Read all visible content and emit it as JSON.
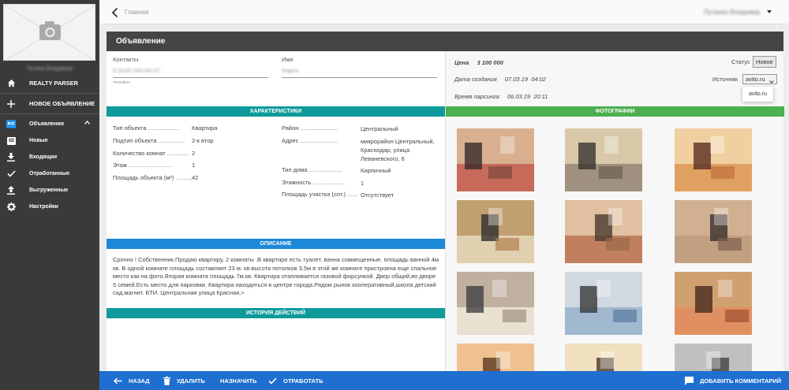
{
  "sidebar": {
    "user_name": "Путина Владимир",
    "items": [
      {
        "label": "REALTY PARSER",
        "icon": "home-icon"
      },
      {
        "label": "НОВОЕ ОБЪЯВЛЕНИЕ",
        "icon": "plus-icon"
      },
      {
        "label": "Объявления",
        "icon": "list-icon"
      },
      {
        "label": "Новые",
        "icon": "inbox-icon"
      },
      {
        "label": "Входящие",
        "icon": "download-icon"
      },
      {
        "label": "Отработанные",
        "icon": "check-icon"
      },
      {
        "label": "Выгруженные",
        "icon": "upload-icon"
      },
      {
        "label": "Настройки",
        "icon": "gear-icon"
      }
    ]
  },
  "topbar": {
    "breadcrumb": "Главная",
    "user_menu": "Путинин Владимир"
  },
  "card": {
    "title": "Объявление",
    "contact": {
      "phone_label": "Контакты",
      "phone_value": "8 (918) 000-00-07",
      "phone_hint": "телефон",
      "name_label": "Имя",
      "name_value": "Марго"
    },
    "info": {
      "price_label": "Цена",
      "price_value": "3 100 000",
      "created_label": "Дата создания",
      "created_value": "07.03.19  04:02",
      "parsed_label": "Время парсинга",
      "parsed_value": "06.03.19  20:11",
      "status_label": "Статус",
      "status_value": "Новое",
      "source_label": "Источник",
      "source_value": "avito.ru",
      "source_options": [
        "avito.ru"
      ]
    },
    "sections": {
      "characteristics": "ХАРАКТЕРИСТИКИ",
      "photos": "ФОТОГРАФИИ",
      "description": "ОПИСАНИЕ",
      "history": "ИСТОРИЯ ДЕЙСТВИЙ"
    },
    "characteristics_left": [
      {
        "label": "Тип объекта",
        "value": "Квартира"
      },
      {
        "label": "Подтип объекта",
        "value": "2-к втор"
      },
      {
        "label": "Количество комнат",
        "value": "2"
      },
      {
        "label": "Этаж",
        "value": "1"
      },
      {
        "label": "Площадь объекта (м²)",
        "value": "42"
      }
    ],
    "characteristics_right": [
      {
        "label": "Район",
        "value": "Центральный"
      },
      {
        "label": "Адрес",
        "value": "микрорайон Центральный, Краснодар, улица Леваневского, 6"
      },
      {
        "label": "Тип дома",
        "value": "Кирпичный"
      },
      {
        "label": "Этажность",
        "value": "1"
      },
      {
        "label": "Площадь участка (сот.)",
        "value": "Отсутствует"
      }
    ],
    "description": "Срочно ! Собственник.Продаю квартиру, 2 комнаты .В квартире есть туалет, ванна совмещенные. площадь ванной 4м кв. В одной комнате площадь составляет 23 м. кв.высота потолков 3,5м в этой же комнате пристроена еще спальное место как на фото.Вторая комната площадь 7м.кв. Квартира отапливается газовой форсункой. Двор общий,во дворе 5 семей.Есть место для парковки. Квартира находиться в центре города.Рядом рынок кооперативный,школа детский сад.магнит. БТИ. Центральная улица Красная.>"
  },
  "bottombar": {
    "back": "НАЗАД",
    "delete": "УДАЛИТЬ",
    "assign": "НАЗНАЧИТЬ",
    "done": "ОТРАБОТАТЬ",
    "comment": "ДОБАВИТЬ КОММЕНТАРИЙ"
  },
  "colors": {
    "teal": "#0e9a9b",
    "blue": "#1e88d8",
    "green": "#4caf50",
    "bottom_bar": "#1e6fd0",
    "sidebar": "#3a3a3a"
  }
}
